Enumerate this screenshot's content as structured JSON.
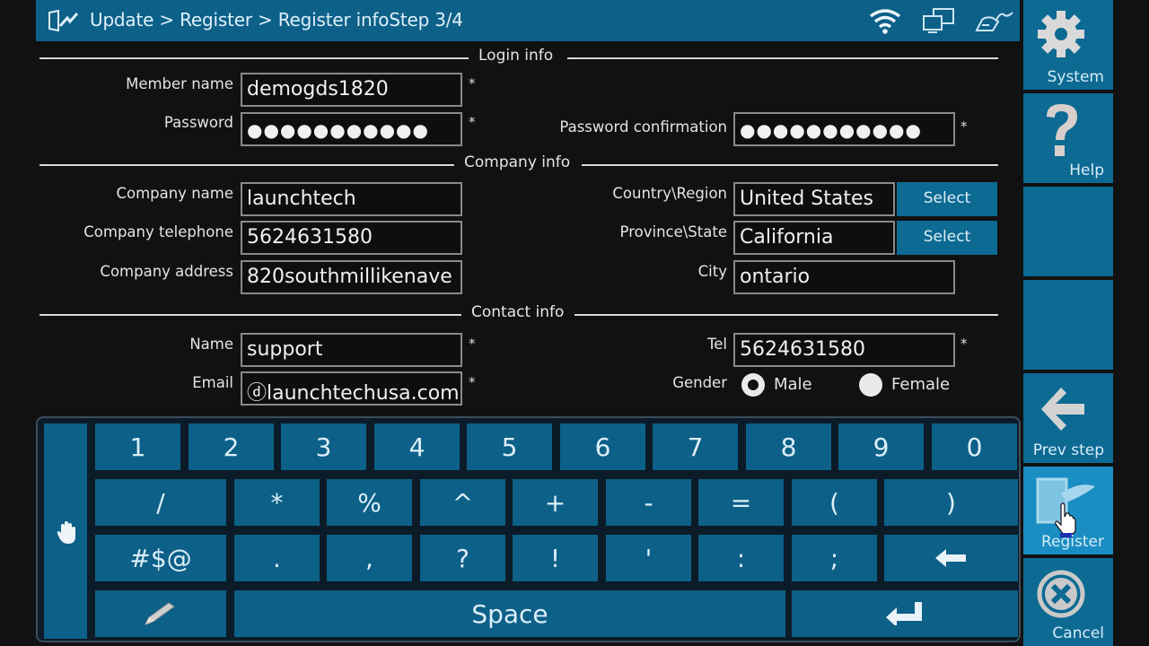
{
  "titlebar": {
    "title": "Update > Register > Register infoStep 3/4",
    "icons": [
      "update-icon",
      "wifi-icon",
      "network-icon",
      "vci-connector-icon"
    ]
  },
  "sections": {
    "login": "Login info",
    "company": "Company info",
    "contact": "Contact info"
  },
  "login": {
    "member_name": {
      "label": "Member name",
      "value": "demogds1820",
      "required": "*"
    },
    "password": {
      "label": "Password",
      "value": "●●●●●●●●●●●",
      "required": "*"
    },
    "password_confirmation": {
      "label": "Password confirmation",
      "value": "●●●●●●●●●●●",
      "required": "*"
    }
  },
  "company": {
    "name": {
      "label": "Company name",
      "value": "launchtech"
    },
    "telephone": {
      "label": "Company telephone",
      "value": "5624631580"
    },
    "address": {
      "label": "Company address",
      "value": "820southmillikenave"
    },
    "country": {
      "label": "Country\\Region",
      "value": "United States",
      "button": "Select"
    },
    "province": {
      "label": "Province\\State",
      "value": "California",
      "button": "Select"
    },
    "city": {
      "label": "City",
      "value": "ontario"
    }
  },
  "contact": {
    "name": {
      "label": "Name",
      "value": "support",
      "required": "*"
    },
    "email": {
      "label": "Email",
      "value": "ⓓlaunchtechusa.com",
      "required": "*"
    },
    "tel": {
      "label": "Tel",
      "value": "5624631580",
      "required": "*"
    },
    "gender": {
      "label": "Gender",
      "options": [
        {
          "label": "Male",
          "selected": true
        },
        {
          "label": "Female",
          "selected": false
        }
      ]
    }
  },
  "keyboard": {
    "row1": [
      "1",
      "2",
      "3",
      "4",
      "5",
      "6",
      "7",
      "8",
      "9",
      "0"
    ],
    "row2": [
      "/",
      "*",
      "%",
      "^",
      "+",
      "-",
      "=",
      "(",
      ")"
    ],
    "row3": [
      "#$@",
      ".",
      ",",
      "?",
      "!",
      "'",
      ":",
      ";"
    ],
    "space": "Space",
    "icons": {
      "side": "hand-icon",
      "edit": "pencil-icon",
      "backspace": "backspace-arrow-icon",
      "enter": "enter-icon"
    }
  },
  "sidebar": {
    "items": [
      {
        "label": "System",
        "icon": "gear-icon"
      },
      {
        "label": "Help",
        "icon": "question-icon"
      },
      {
        "label": "",
        "icon": ""
      },
      {
        "label": "",
        "icon": ""
      },
      {
        "label": "Prev step",
        "icon": "back-arrow-icon"
      },
      {
        "label": "Register",
        "icon": "register-icon",
        "active": true
      },
      {
        "label": "Cancel",
        "icon": "cancel-icon"
      }
    ]
  },
  "colors": {
    "accent": "#0d6088",
    "active": "#1a8dc2",
    "background": "#111111"
  }
}
